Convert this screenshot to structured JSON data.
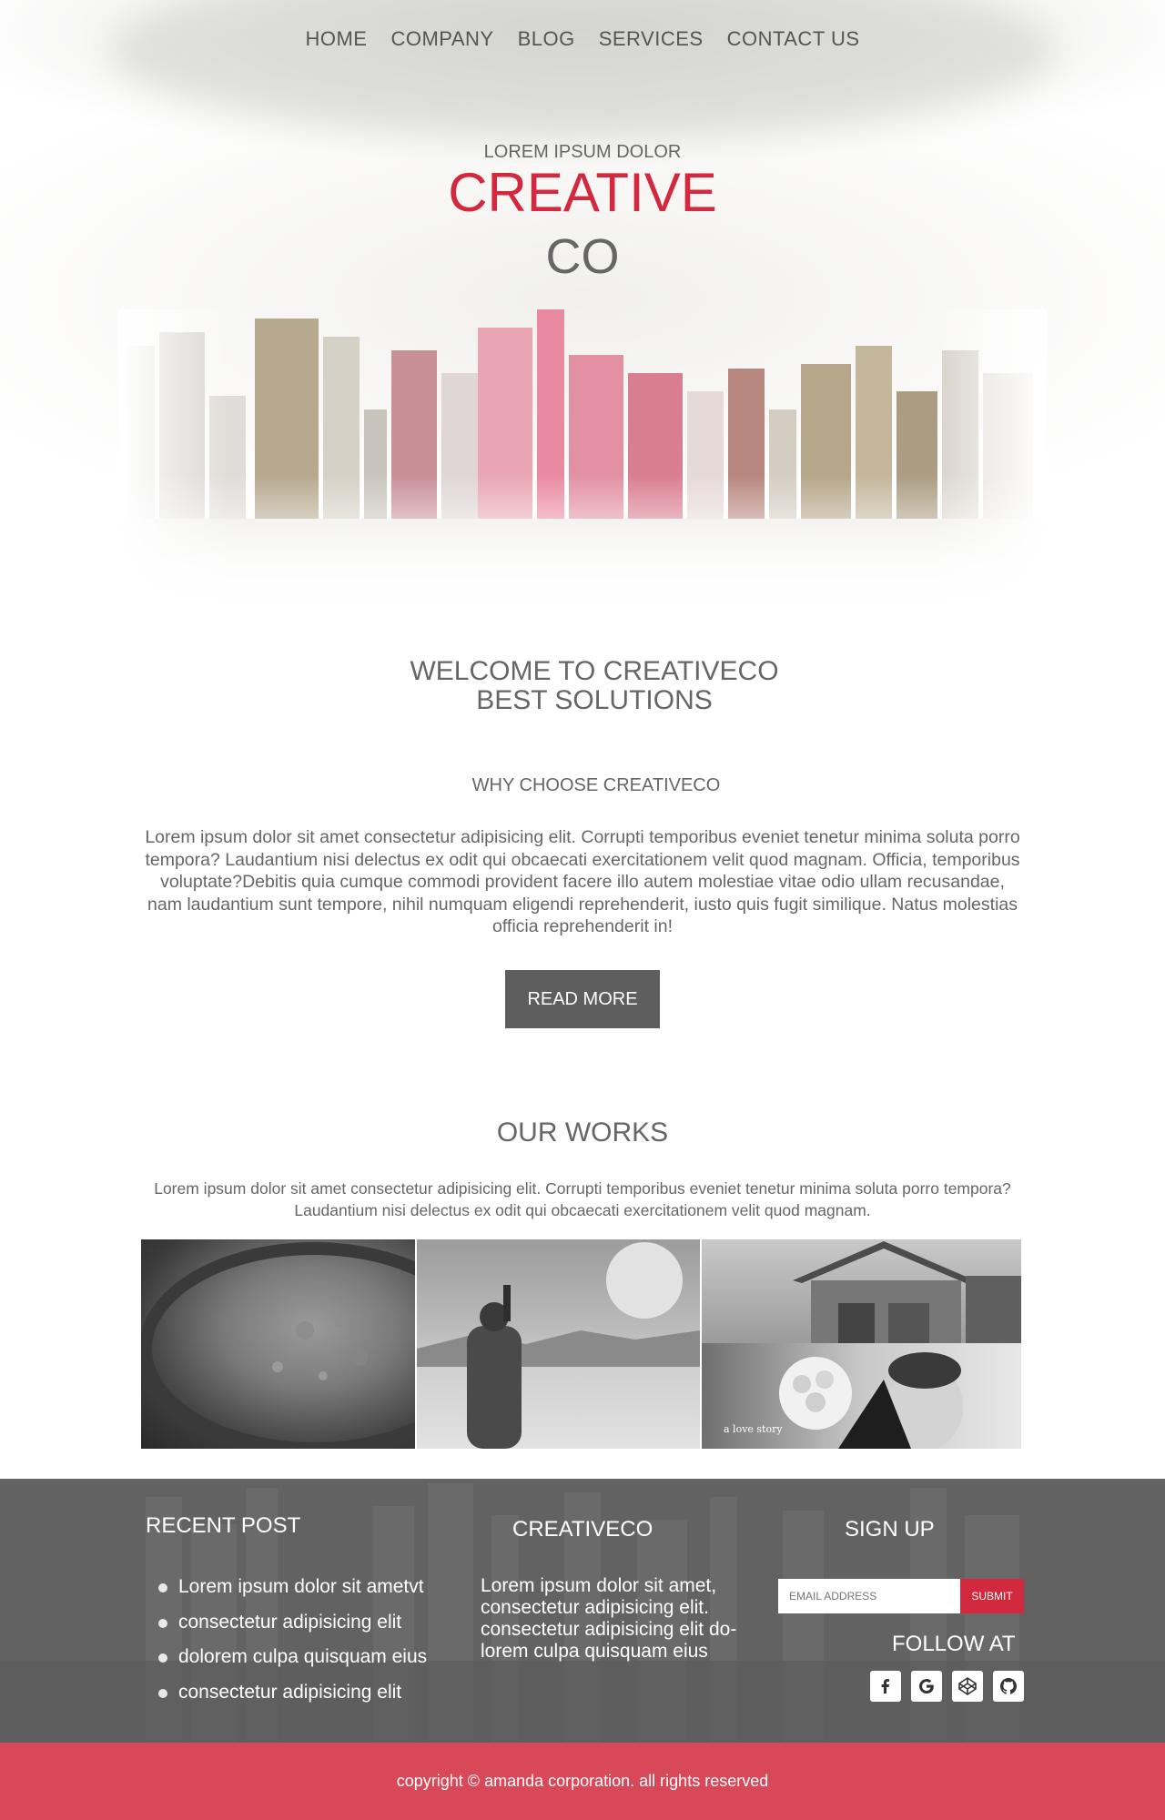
{
  "nav": {
    "items": [
      "HOME",
      "COMPANY",
      "BLOG",
      "SERVICES",
      "CONTACT US"
    ]
  },
  "hero": {
    "kicker": "LOREM IPSUM DOLOR",
    "title": "CREATIVE",
    "subtitle": "CO"
  },
  "welcome": {
    "line1": "WELCOME TO CREATIVECO",
    "line2": "BEST SOLUTIONS",
    "why_heading": "WHY CHOOSE CREATIVECO",
    "paragraph": "Lorem ipsum dolor sit amet consectetur adipisicing elit. Corrupti temporibus eveniet tenetur minima soluta porro tempora? Laudantium nisi delectus ex odit qui obcaecati exercitationem velit quod magnam. Officia, temporibus voluptate?Debitis quia cumque commodi provident facere illo autem molestiae vitae odio ullam recusandae, nam laudantium sunt tempore, nihil numquam eligendi reprehenderit, iusto quis fugit similique. Natus molestias officia reprehenderit in!",
    "read_more": "READ MORE"
  },
  "works": {
    "title": "OUR WORKS",
    "paragraph": "Lorem ipsum dolor sit amet consectetur adipisicing elit. Corrupti temporibus eveniet tenetur minima soluta porro tempora? Laudantium nisi delectus ex odit qui obcaecati exercitationem velit quod magnam.",
    "wedding_caption": "a love story"
  },
  "footer": {
    "recent_heading": "RECENT POST",
    "recent_items": [
      "Lorem ipsum dolor sit ametvt",
      "consectetur adipisicing elit",
      "dolorem culpa quisquam eius",
      "consectetur adipisicing elit"
    ],
    "brand_heading": "CREATIVECO",
    "brand_text": "Lorem ipsum dolor sit amet, consectetur adipisicing elit. consectetur adipisicing elit do- lorem culpa quisquam eius",
    "signup_heading": "SIGN UP",
    "email_placeholder": "EMAIL ADDRESS",
    "submit_label": "SUBMIT",
    "follow_heading": "FOLLOW AT",
    "social_icons": [
      "facebook-icon",
      "google-icon",
      "codepen-icon",
      "github-icon"
    ]
  },
  "copyright": "copyright © amanda corporation. all rights reserved",
  "colors": {
    "accent": "#d2293f",
    "footer_bg": "#626262",
    "copyright_bg": "#d94858",
    "button_bg": "#5e5e5e"
  }
}
